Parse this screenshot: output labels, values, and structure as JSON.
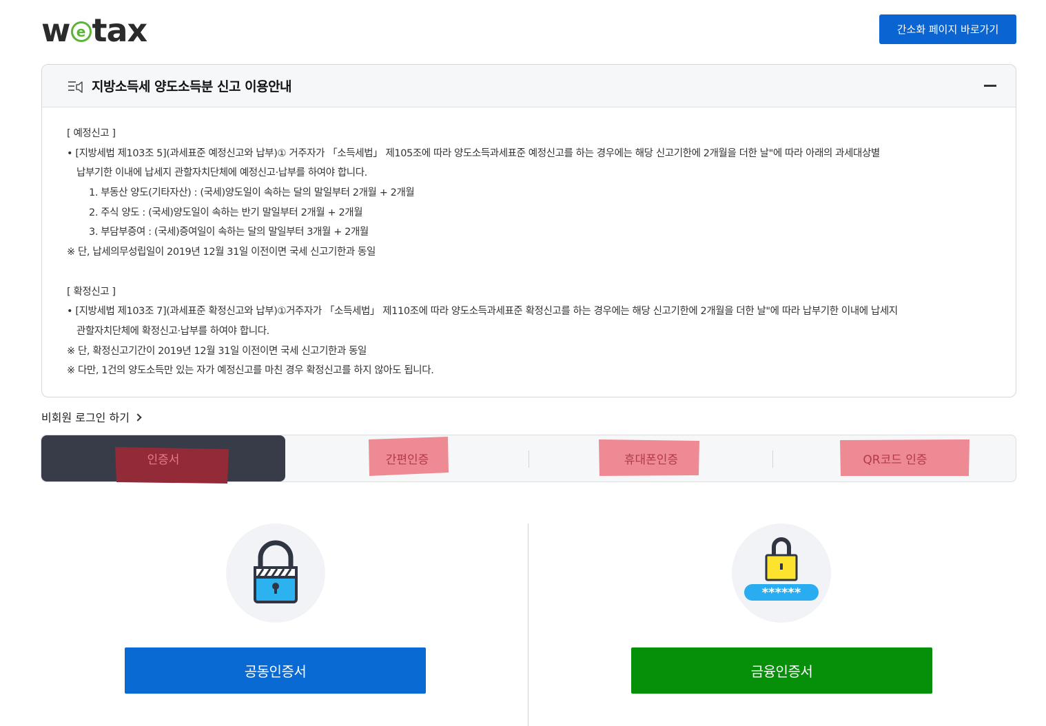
{
  "header": {
    "logo": {
      "before": "w",
      "ring": "e",
      "after": "tax",
      "accent_color": "#5ab435"
    },
    "simple_page_button": "간소화 페이지 바로가기"
  },
  "guide": {
    "title": "지방소득세 양도소득분 신고 이용안내",
    "icon": "notice-list-icon",
    "lines": [
      {
        "cls": "",
        "text": "[ 예정신고 ]"
      },
      {
        "cls": "",
        "text": "• [지방세법 제103조 5](과세표준 예정신고와 납부)① 거주자가 「소득세법」 제105조에 따라 양도소득과세표준 예정신고를 하는 경우에는 해당 신고기한에 2개월을 더한 날\"에 따라 아래의 과세대상별"
      },
      {
        "cls": "ind1",
        "text": "납부기한 이내에 납세지 관할자치단체에 예정신고·납부를 하여야 합니다."
      },
      {
        "cls": "ind2",
        "text": "1. 부동산 양도(기타자산) : (국세)양도일이 속하는 달의 말일부터 2개월 + 2개월"
      },
      {
        "cls": "ind2",
        "text": "2. 주식 양도 : (국세)양도일이 속하는 반기 말일부터 2개월 + 2개월"
      },
      {
        "cls": "ind2",
        "text": "3. 부담부증여 : (국세)증여일이 속하는 달의 말일부터 3개월 + 2개월"
      },
      {
        "cls": "",
        "text": "※ 단, 납세의무성립일이 2019년 12월 31일 이전이면 국세 신고기한과 동일"
      },
      {
        "cls": "gap",
        "text": ""
      },
      {
        "cls": "",
        "text": "[ 확정신고 ]"
      },
      {
        "cls": "",
        "text": "• [지방세법 제103조 7](과세표준 확정신고와 납부)①거주자가 「소득세법」 제110조에 따라 양도소득과세표준 확정신고를 하는 경우에는 해당 신고기한에 2개월을 더한 날\"에 따라 납부기한 이내에 납세지"
      },
      {
        "cls": "ind1",
        "text": "관할자치단체에 확정신고·납부를 하여야 합니다."
      },
      {
        "cls": "",
        "text": "※ 단, 확정신고기간이 2019년 12월 31일 이전이면 국세 신고기한과 동일"
      },
      {
        "cls": "",
        "text": "※ 다만, 1건의 양도소득만 있는 자가 예정신고를 마친 경우 확정신고를 하지 않아도 됩니다."
      }
    ]
  },
  "nonmember_login": "비회원 로그인 하기",
  "tabs": [
    {
      "label": "인증서",
      "active": true
    },
    {
      "label": "간편인증",
      "active": false
    },
    {
      "label": "휴대폰인증",
      "active": false
    },
    {
      "label": "QR코드 인증",
      "active": false
    }
  ],
  "colors": {
    "primary_blue": "#0a64d2",
    "finance_green": "#06900a",
    "active_tab": "#383b48",
    "highlight_pink": "#ee8a94",
    "highlight_dark": "#932a38"
  },
  "certificates": [
    {
      "icon": "padlock-icon",
      "button": "공동인증서"
    },
    {
      "icon": "password-lock-icon",
      "button": "금융인증서",
      "password_mask": "******"
    }
  ]
}
